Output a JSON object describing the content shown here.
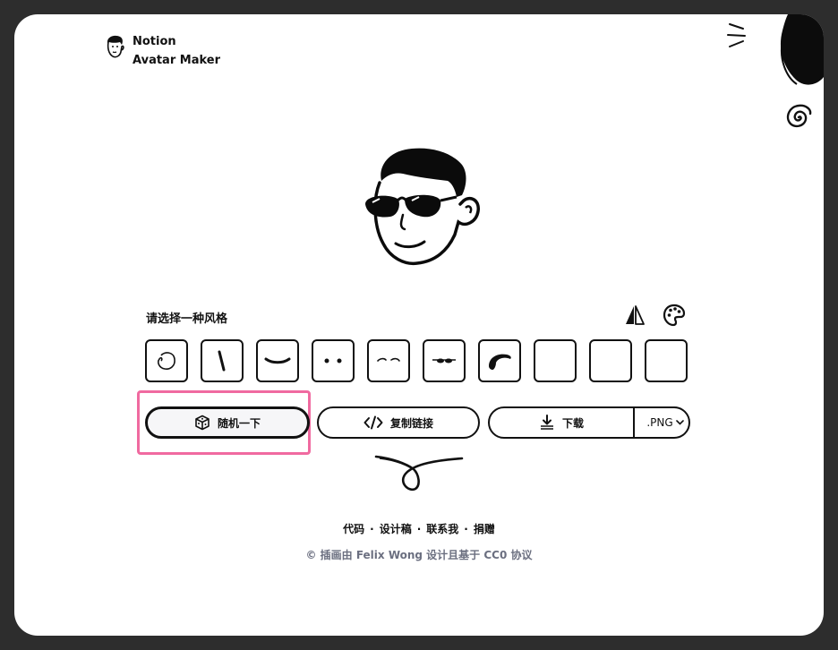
{
  "brand": {
    "line1": "Notion",
    "line2": "Avatar Maker"
  },
  "style_section": {
    "label": "请选择一种风格"
  },
  "tiles": [
    {
      "name": "face",
      "icon": "face-outline-icon"
    },
    {
      "name": "nose",
      "icon": "nose-line-icon"
    },
    {
      "name": "mouth",
      "icon": "mouth-curve-icon"
    },
    {
      "name": "eyes",
      "icon": "eyes-dots-icon"
    },
    {
      "name": "eyebrows",
      "icon": "eyebrows-icon"
    },
    {
      "name": "glasses",
      "icon": "glasses-icon"
    },
    {
      "name": "hair",
      "icon": "hair-icon"
    },
    {
      "name": "accessories",
      "icon": "empty"
    },
    {
      "name": "details",
      "icon": "empty"
    },
    {
      "name": "beard",
      "icon": "empty"
    }
  ],
  "actions": {
    "random_label": "随机一下",
    "copy_label": "复制链接",
    "download_label": "下载",
    "format_label": ".PNG"
  },
  "footer": {
    "links": [
      "代码",
      "设计稿",
      "联系我",
      "捐赠"
    ],
    "separator": "·",
    "credit": "© 插画由 Felix Wong 设计且基于 CC0 协议"
  }
}
